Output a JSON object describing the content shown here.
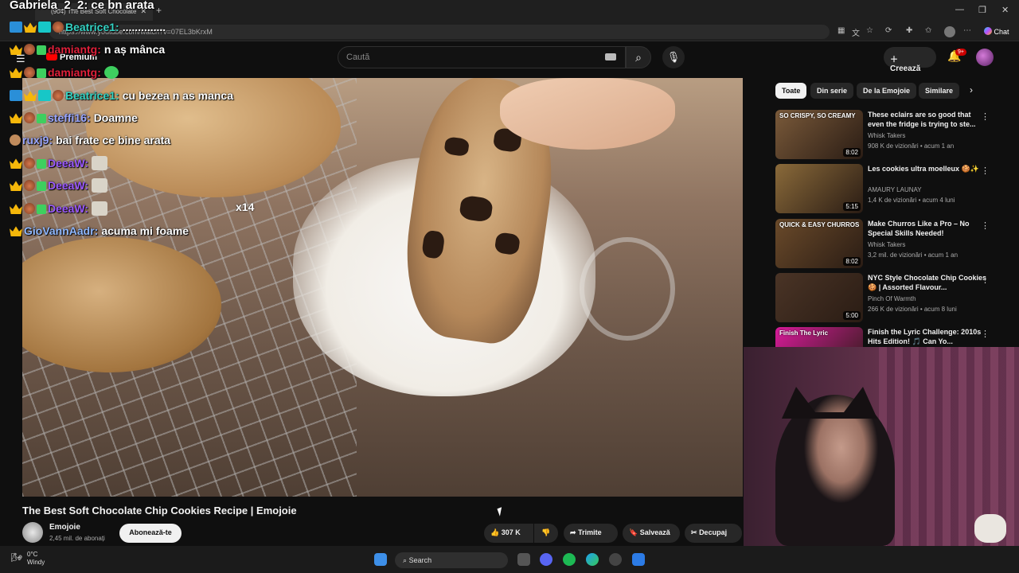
{
  "browser": {
    "tab_title": "(904) The Best Soft Chocolate",
    "url": "https://www.youtube.com/watch?v=07EL3bKrxM",
    "chat_label": "Chat"
  },
  "youtube": {
    "premium_label": "Premium",
    "search_placeholder": "Caută",
    "create_label": "Creează",
    "notif_badge": "9+",
    "chips": [
      "Toate",
      "Din serie",
      "De la Emojoie",
      "Similare"
    ],
    "video_title": "The Best Soft Chocolate Chip Cookies Recipe | Emojoie",
    "channel": {
      "name": "Emojoie",
      "subscribers": "2,45 mil. de abonați"
    },
    "subscribe_label": "Abonează-te",
    "actions": {
      "likes": "307 K",
      "share": "Trimite",
      "save": "Salvează",
      "clip": "Decupaj"
    },
    "recommendations": [
      {
        "title": "These eclairs are so good that even the fridge is trying to ste...",
        "channel": "Whisk Takers",
        "meta": "908 K de vizionări • acum 1 an",
        "duration": "8:02",
        "thumb_text": "SO CRISPY, SO CREAMY",
        "color": "#7a5a3a"
      },
      {
        "title": "Les cookies ultra moelleux 🍪✨",
        "channel": "AMAURY LAUNAY",
        "meta": "1,4 K de vizionări • acum 4 luni",
        "duration": "5:15",
        "thumb_text": "",
        "color": "#8a6a3a"
      },
      {
        "title": "Make Churros Like a Pro – No Special Skills Needed!",
        "channel": "Whisk Takers",
        "meta": "3,2 mil. de vizionări • acum 1 an",
        "duration": "8:02",
        "thumb_text": "QUICK & EASY CHURROS",
        "color": "#6a4a2a"
      },
      {
        "title": "NYC Style Chocolate Chip Cookies 🍪 | Assorted Flavour...",
        "channel": "Pinch Of Warmth",
        "meta": "266 K de vizionări • acum 8 luni",
        "duration": "5:00",
        "thumb_text": "",
        "color": "#4a3426"
      },
      {
        "title": "Finish the Lyric Challenge: 2010s Hits Edition! 🎵 Can Yo...",
        "channel": "",
        "meta": "",
        "duration": "",
        "thumb_text": "Finish The Lyric",
        "color": "#d81b9a"
      }
    ]
  },
  "stream_chat": [
    {
      "name": "Gabriela_2_2:",
      "msg": "ce bn arata",
      "name_color": "#ffffff"
    },
    {
      "name": "Beatrice1:",
      "msg": "..............",
      "name_color": "#34d3c4"
    },
    {
      "name": "damiantg:",
      "msg": "n aș mânca",
      "name_color": "#e0203a"
    },
    {
      "name": "damiantg:",
      "msg": "",
      "name_color": "#e0203a"
    },
    {
      "name": "Beatrice1:",
      "msg": "cu bezea n as manca",
      "name_color": "#34d3c4"
    },
    {
      "name": "steffi16:",
      "msg": "Doamne",
      "name_color": "#9aa7ff"
    },
    {
      "name": "ruxj9:",
      "msg": "bai frate ce bine arata",
      "name_color": "#9aa7ff"
    },
    {
      "name": "DeeaW:",
      "msg": "",
      "name_color": "#9b59ff"
    },
    {
      "name": "DeeaW:",
      "msg": "",
      "name_color": "#9b59ff"
    },
    {
      "name": "DeeaW:",
      "msg": "",
      "name_color": "#9b59ff"
    },
    {
      "name": "GioVannAadr:",
      "msg": "acuma mi foame",
      "name_color": "#8fb8ff"
    }
  ],
  "webcam": {
    "counter": "x14"
  },
  "taskbar": {
    "temperature": "0°C",
    "weather": "Windy",
    "search_label": "Search"
  }
}
